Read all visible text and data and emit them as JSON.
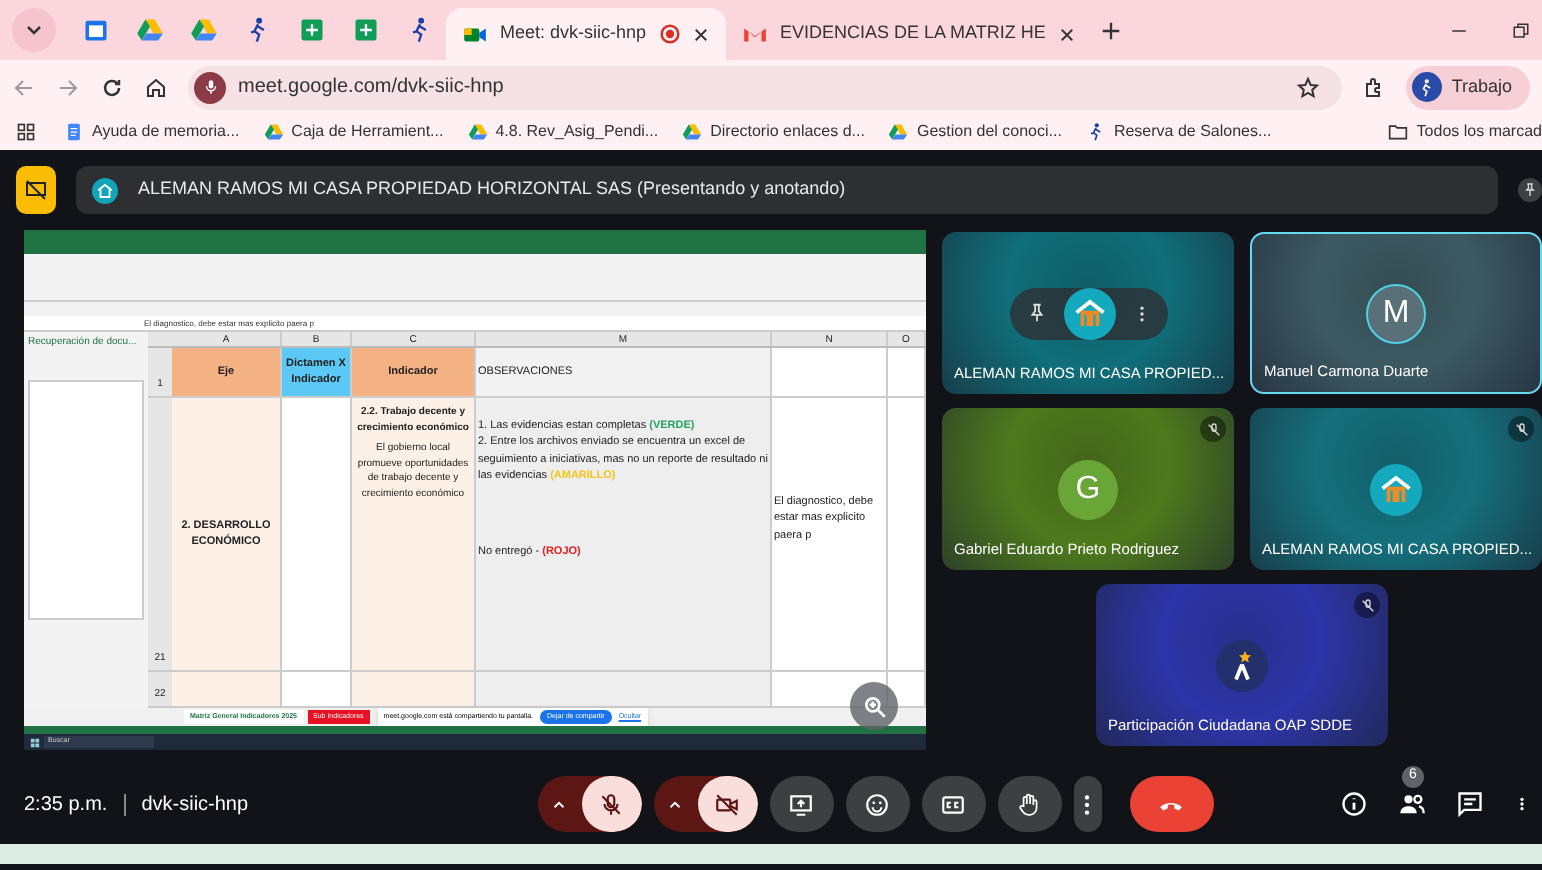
{
  "browser": {
    "pinned_tabs": [
      {
        "kind": "calendar"
      },
      {
        "kind": "drive"
      },
      {
        "kind": "drive"
      },
      {
        "kind": "person"
      },
      {
        "kind": "sheet"
      },
      {
        "kind": "sheet"
      },
      {
        "kind": "person"
      }
    ],
    "tabs": [
      {
        "kind": "meet",
        "title": "Meet: dvk-siic-hnp",
        "selected": true,
        "recording": true
      },
      {
        "kind": "gmail",
        "title": "EVIDENCIAS DE LA MATRIZ HE",
        "selected": false,
        "recording": false
      }
    ],
    "url": "meet.google.com/dvk-siic-hnp",
    "profile": "Trabajo",
    "bookmarks": [
      {
        "kind": "doc",
        "label": "Ayuda de memoria..."
      },
      {
        "kind": "drive",
        "label": "Caja de Herramient..."
      },
      {
        "kind": "drive",
        "label": "4.8. Rev_Asig_Pendi..."
      },
      {
        "kind": "drive",
        "label": "Directorio enlaces d..."
      },
      {
        "kind": "drive",
        "label": "Gestion del conoci..."
      },
      {
        "kind": "person",
        "label": "Reserva de Salones..."
      }
    ],
    "all_bookmarks": "Todos los marcad"
  },
  "presenting": {
    "label": "ALEMAN RAMOS MI CASA PROPIEDAD HORIZONTAL SAS (Presentando y anotando)"
  },
  "shared_screen": {
    "recovery_title": "Recuperación de docu...",
    "formula": "El diagnostico, debe estar mas explicito paera p",
    "columns": [
      {
        "letter": "A",
        "heading": "Eje",
        "color": "#f4b183"
      },
      {
        "letter": "B",
        "heading": "Dictamen X Indicador",
        "color": "#5bc8f5"
      },
      {
        "letter": "C",
        "heading": "Indicador",
        "color": "#f4b183"
      },
      {
        "letter": "M",
        "heading": "OBSERVACIONES",
        "color": "#f2f2f2"
      },
      {
        "letter": "N",
        "color": "#ffffff"
      },
      {
        "letter": "O",
        "color": "#ffffff"
      }
    ],
    "row_numbers": [
      "1",
      "21",
      "22"
    ],
    "eje": "2. DESARROLLO ECONÓMICO",
    "indicator_title": "2.2. Trabajo decente y crecimiento económico",
    "indicator_text": "El gobierno local promueve oportunidades de trabajo decente y crecimiento económico",
    "observations": [
      {
        "text": "1. Las evidencias estan completas",
        "tag": "(VERDE)",
        "color": "#22a559"
      },
      {
        "text": "2. Entre los archivos enviado se encuentra un excel de seguimiento a iniciativas, mas no un reporte de resultado ni las evidencias",
        "tag": "(AMARILLO)",
        "color": "#f5c518"
      }
    ],
    "missing": {
      "text": "No entregó -",
      "tag": "(ROJO)",
      "color": "#e02020"
    },
    "comment": "El diagnostico, debe estar mas explicito paera p",
    "sheet_tabs": [
      {
        "label": "Matriz General Indicadores 2025",
        "selected": true
      },
      {
        "label": "Sub Indicadores",
        "selected": false
      }
    ],
    "share_notice": "meet.google.com está compartiendo tu pantalla.",
    "stop_button": "Dejar de compartir",
    "hide_link": "Ocultar",
    "taskbar_search": "Buscar"
  },
  "participants": [
    {
      "name": "ALEMAN RAMOS MI CASA PROPIED...",
      "kind": "logo",
      "color": "#0f6f7a",
      "muted": false,
      "speaking": false,
      "hovered": true
    },
    {
      "name": "Manuel Carmona Duarte",
      "kind": "letter",
      "initial": "M",
      "color": "#3d5a62",
      "muted": false,
      "speaking": true,
      "hovered": false
    },
    {
      "name": "Gabriel Eduardo Prieto Rodriguez",
      "kind": "letter",
      "initial": "G",
      "color": "#4e7a1c",
      "muted": true,
      "speaking": false,
      "hovered": false
    },
    {
      "name": "ALEMAN RAMOS MI CASA PROPIED...",
      "kind": "logo",
      "color": "#14707c",
      "muted": true,
      "speaking": false,
      "hovered": false
    },
    {
      "name": "Participación Ciudadana OAP SDDE",
      "kind": "star",
      "color": "#2d35a8",
      "muted": true,
      "speaking": false,
      "hovered": false
    }
  ],
  "controls": {
    "time": "2:35 p.m.",
    "meeting_code": "dvk-siic-hnp",
    "mic_on": false,
    "camera_on": false,
    "participant_count": "6"
  }
}
